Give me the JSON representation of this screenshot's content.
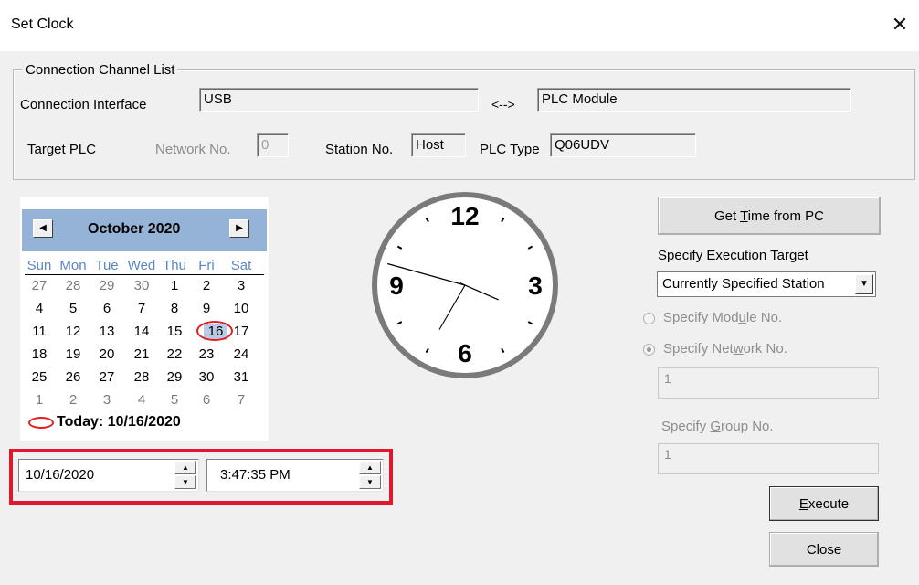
{
  "window": {
    "title": "Set Clock",
    "close_glyph": "✕"
  },
  "connection": {
    "group_title": "Connection Channel List",
    "interface_label": "Connection Interface",
    "interface_value": "USB",
    "arrow": "<-->",
    "module_value": "PLC Module",
    "target_label": "Target PLC",
    "network_label": "Network No.",
    "network_value": "0",
    "station_label": "Station No.",
    "station_value": "Host",
    "plctype_label": "PLC Type",
    "plctype_value": "Q06UDV"
  },
  "calendar": {
    "month_title": "October 2020",
    "prev_glyph": "◀",
    "next_glyph": "▶",
    "weekdays": [
      "Sun",
      "Mon",
      "Tue",
      "Wed",
      "Thu",
      "Fri",
      "Sat"
    ],
    "weeks": [
      [
        "27",
        "28",
        "29",
        "30",
        "1",
        "2",
        "3"
      ],
      [
        "4",
        "5",
        "6",
        "7",
        "8",
        "9",
        "10"
      ],
      [
        "11",
        "12",
        "13",
        "14",
        "15",
        "16",
        "17"
      ],
      [
        "18",
        "19",
        "20",
        "21",
        "22",
        "23",
        "24"
      ],
      [
        "25",
        "26",
        "27",
        "28",
        "29",
        "30",
        "31"
      ],
      [
        "1",
        "2",
        "3",
        "4",
        "5",
        "6",
        "7"
      ]
    ],
    "today_label": "Today: 10/16/2020"
  },
  "datetime": {
    "date_value": "10/16/2020",
    "time_value": "3:47:35 PM"
  },
  "clock": {
    "time": "3:47:35 PM",
    "numerals": {
      "twelve": "12",
      "three": "3",
      "six": "6",
      "nine": "9"
    }
  },
  "actions": {
    "get_time_button": {
      "before": "Get ",
      "accel": "T",
      "after": "ime from PC"
    },
    "exec_target_label": {
      "before": "",
      "accel": "S",
      "after": "pecify Execution Target"
    },
    "exec_target_value": "Currently Specified Station",
    "module_radio": {
      "before": "Specify Mod",
      "accel": "u",
      "after": "le No."
    },
    "network_radio": {
      "before": "Specify Net",
      "accel": "w",
      "after": "ork No."
    },
    "network_input_value": "1",
    "group_label": {
      "before": "Specify ",
      "accel": "G",
      "after": "roup No."
    },
    "group_input_value": "1",
    "execute_button": {
      "before": "",
      "accel": "E",
      "after": "xecute"
    },
    "close_button": "Close"
  },
  "colors": {
    "calendar_header": "#95b3d7",
    "weekday_text": "#5b86c3",
    "annotation_red": "#e0182d",
    "selected_day_bg": "#b9cbe6"
  }
}
